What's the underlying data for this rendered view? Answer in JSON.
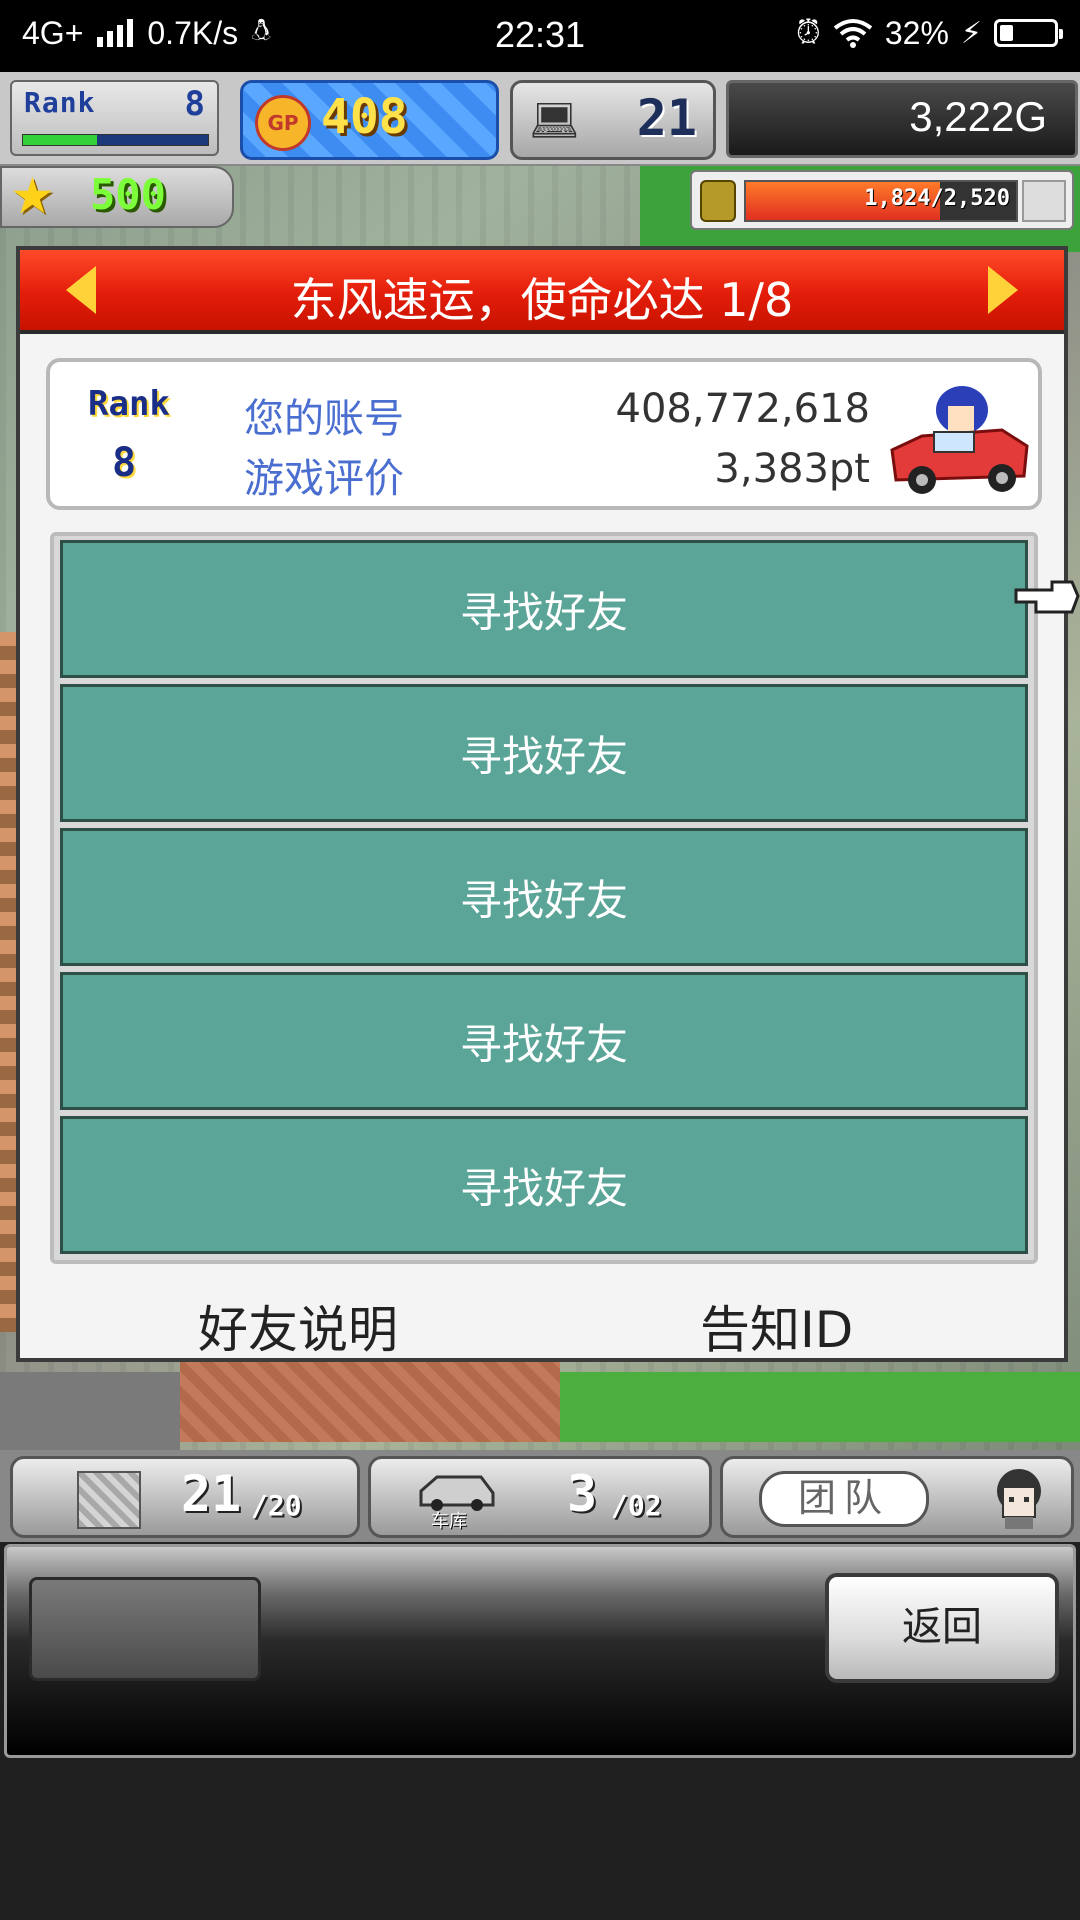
{
  "status_bar": {
    "network": "4G+",
    "speed": "0.7K/s",
    "time": "22:31",
    "battery": "32%",
    "battery_level": 0.32
  },
  "hud": {
    "rank_label": "Rank",
    "rank_value": "8",
    "rank_progress": 0.4,
    "gp_icon_label": "GP",
    "gp_value": "408",
    "research_value": "21",
    "money": "3,222G",
    "stars": "500",
    "funds_text": "1,824/2,520",
    "funds_progress": 0.72
  },
  "panel": {
    "title": "东风速运，使命必达 1/8",
    "rank_label": "Rank",
    "rank_value": "8",
    "account_label": "您的账号",
    "account_value": "408,772,618",
    "rating_label": "游戏评价",
    "rating_value": "3,383pt",
    "friend_slots": [
      "寻找好友",
      "寻找好友",
      "寻找好友",
      "寻找好友",
      "寻找好友"
    ],
    "friend_info_link": "好友说明",
    "notify_id_link": "告知ID"
  },
  "toolbar": {
    "cargo_count": "21",
    "cargo_max": "/20",
    "garage_label": "车库",
    "garage_count": "3",
    "garage_max": "/02",
    "team_label": "团队"
  },
  "bottom": {
    "back_label": "返回"
  },
  "colors": {
    "title_red": "#e31d0a",
    "friend_slot": "#5aa597",
    "label_blue": "#4a6fd0"
  },
  "icons": [
    "signal-icon",
    "qq-penguin-icon",
    "alarm-icon",
    "wifi-icon",
    "charging-icon",
    "battery-icon",
    "gp-coin-icon",
    "computer-icon",
    "star-icon",
    "coin-stack-icon",
    "arrow-left-icon",
    "arrow-right-icon",
    "car-driver-icon",
    "crate-icon",
    "truck-icon",
    "staff-face-icon"
  ]
}
